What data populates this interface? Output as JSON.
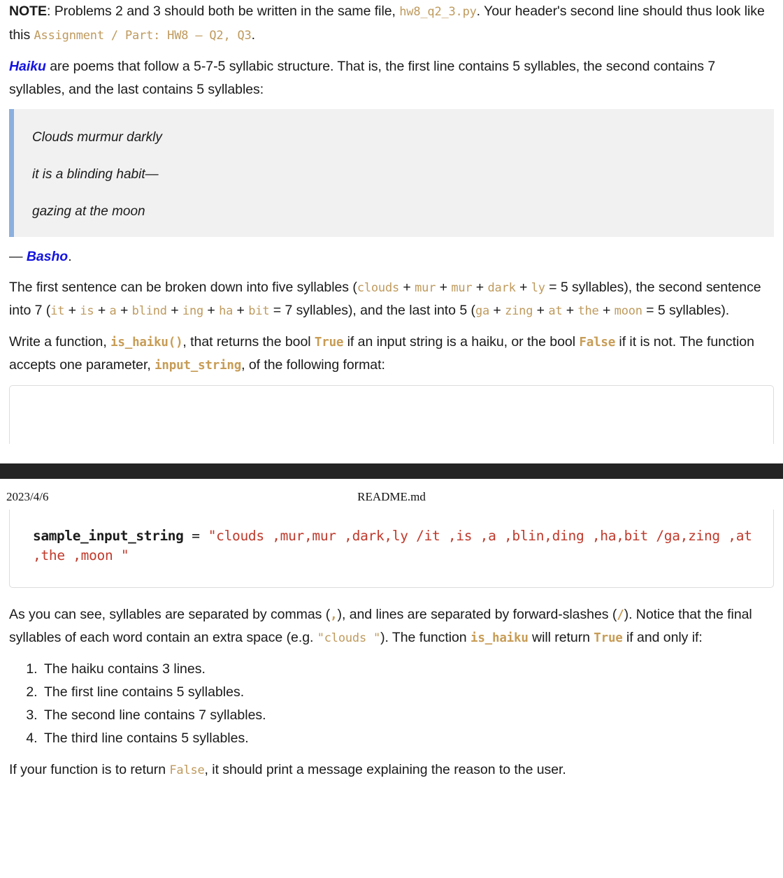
{
  "document": {
    "page_header": {
      "date": "2023/4/6",
      "title": "README.md"
    }
  },
  "note_paragraph": {
    "label": "NOTE",
    "text_1": ": Problems 2 and 3 should both be written in the same file, ",
    "code_filename": "hw8_q2_3.py",
    "text_2": ". Your header's second line should thus look like this ",
    "code_header_line": "Assignment / Part: HW8 – Q2, Q3",
    "text_3": "."
  },
  "haiku_intro": {
    "link_text": "Haiku",
    "text": " are poems that follow a 5-7-5 syllabic structure. That is, the first line contains 5 syllables, the second contains 7 syllables, and the last contains 5 syllables:"
  },
  "blockquote": {
    "lines": [
      "Clouds murmur darkly",
      "it is a blinding habit—",
      "gazing at the moon"
    ]
  },
  "attribution": {
    "dash": "— ",
    "author": "Basho",
    "period": "."
  },
  "breakdown_paragraph": {
    "t1": "The first sentence can be broken down into five syllables (",
    "c1": "clouds",
    "p1": " + ",
    "c2": "mur",
    "p2": " + ",
    "c3": "mur",
    "p3": " + ",
    "c4": "dark",
    "p4": " + ",
    "c5": "ly",
    "t2": " = 5 syllables), the second sentence into 7 (",
    "c6": "it",
    "p5": " + ",
    "c7": "is",
    "p6": " + ",
    "c8": "a",
    "p7": " + ",
    "c9": "blind",
    "p8": " + ",
    "c10": "ing",
    "p9": " + ",
    "c11": "ha",
    "p10": " + ",
    "c12": "bit",
    "t3": " = 7 syllables), and the last into 5 (",
    "c13": "ga",
    "p11": " + ",
    "c14": "zing",
    "p12": " + ",
    "c15": "at",
    "p13": " + ",
    "c16": "the",
    "p14": " + ",
    "c17": "moon",
    "t4": " = 5 syllables)."
  },
  "function_paragraph": {
    "t1": "Write a function, ",
    "c_func": "is_haiku()",
    "t2": ", that returns the bool ",
    "c_true": "True",
    "t3": " if an input string is a haiku, or the bool ",
    "c_false": "False",
    "t4": " if it is not. The function accepts one parameter, ",
    "c_param": "input_string",
    "t5": ", of the following format:"
  },
  "code_block": {
    "variable": "sample_input_string",
    "operator": " = ",
    "string_value": "\"clouds ,mur,mur ,dark,ly /it ,is ,a ,blin,ding ,ha,bit /ga,zing ,at ,the ,moon \""
  },
  "format_paragraph": {
    "t1": "As you can see, syllables are separated by commas (",
    "c_comma": ",",
    "t2": "), and lines are separated by forward-slashes (",
    "c_slash": "/",
    "t3": "). Notice that the final syllables of each word contain an extra space (e.g. ",
    "c_example": "\"clouds \"",
    "t4": "). The function ",
    "c_func": "is_haiku",
    "t5": " will return ",
    "c_true": "True",
    "t6": " if and only if:"
  },
  "rules_list": [
    "The haiku contains 3 lines.",
    "The first line contains 5 syllables.",
    "The second line contains 7 syllables.",
    "The third line contains 5 syllables."
  ],
  "closing_paragraph": {
    "t1": "If your function is to return ",
    "c_false": "False",
    "t2": ", it should print a message explaining the reason to the user."
  },
  "colors": {
    "inline_code": "#bf9a5d",
    "link": "#1414e0",
    "quote_bar": "#8cb0de",
    "quote_bg": "#f1f1f1",
    "code_string": "#c0392b",
    "page_break_bar": "#242424",
    "code_border": "#dcdcdc"
  }
}
